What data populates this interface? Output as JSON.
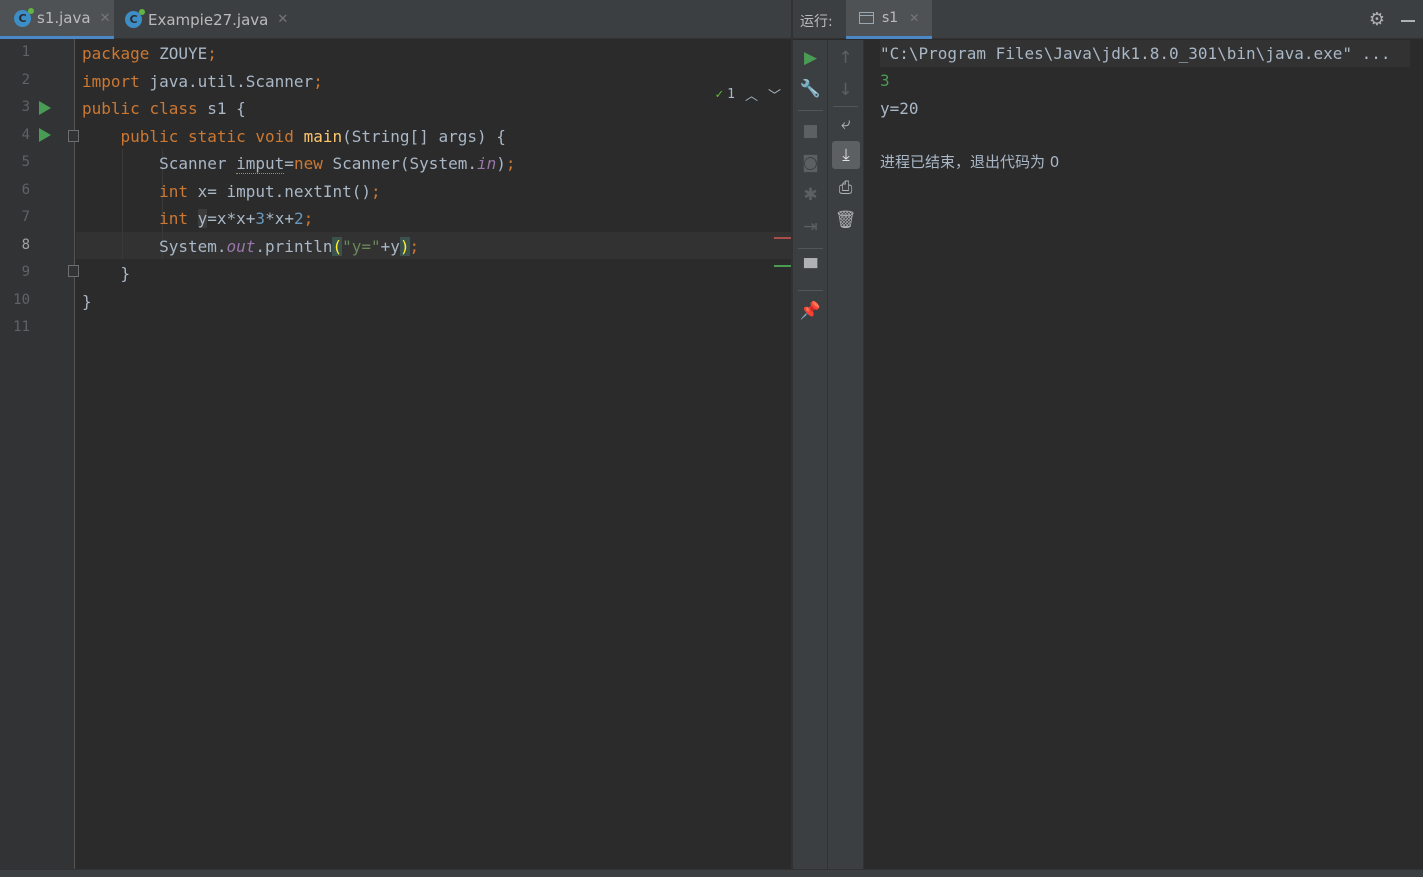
{
  "editor": {
    "tabs": [
      {
        "label": "s1.java",
        "icon": "java-class-icon",
        "active": true
      },
      {
        "label": "Exampie27.java",
        "icon": "java-class-icon",
        "active": false
      }
    ],
    "line_numbers": [
      "1",
      "2",
      "3",
      "4",
      "5",
      "6",
      "7",
      "8",
      "9",
      "10",
      "11"
    ],
    "current_line": 8,
    "inspection_count": "1",
    "code": {
      "l1": {
        "kw": "package",
        "rest": " ZOUYE",
        "semi": ";"
      },
      "l2": {
        "kw": "import",
        "rest": " java.util.Scanner",
        "semi": ";"
      },
      "l3": {
        "kw1": "public",
        "kw2": "class",
        "rest": " s1 {"
      },
      "l4": {
        "kw1": "public",
        "kw2": "static",
        "kw3": "void",
        "fn": "main",
        "rest": "(String[] args) {"
      },
      "l5": {
        "a": "Scanner ",
        "var": "imput",
        "eq": "=",
        "kw": "new",
        "b": " Scanner(System.",
        "fld": "in",
        "c": ")",
        "semi": ";"
      },
      "l6": {
        "kw": "int",
        "a": " x= imput.nextInt()",
        "semi": ";"
      },
      "l7": {
        "kw": "int",
        "var": "y",
        "a": "=x*x+",
        "n1": "3",
        "b": "*x+",
        "n2": "2",
        "semi": ";"
      },
      "l8": {
        "a": "System.",
        "fld": "out",
        "b": ".println",
        "p1": "(",
        "str": "\"y=\"",
        "c": "+y",
        "p2": ")",
        "semi": ";"
      },
      "l9": {
        "a": "}"
      },
      "l10": {
        "a": "}"
      }
    }
  },
  "run": {
    "title": "运行:",
    "tab_label": "s1",
    "console": {
      "command": "\"C:\\Program Files\\Java\\jdk1.8.0_301\\bin\\java.exe\" ...",
      "input": "3",
      "output": "y=20",
      "exit_message": "进程已结束，退出代码为 0"
    }
  },
  "colors": {
    "keyword": "#cc7832",
    "function": "#ffc66d",
    "number": "#6897bb",
    "string": "#6a8759",
    "field": "#9876aa",
    "run_green": "#499c54",
    "tab_underline": "#4a88c7"
  }
}
